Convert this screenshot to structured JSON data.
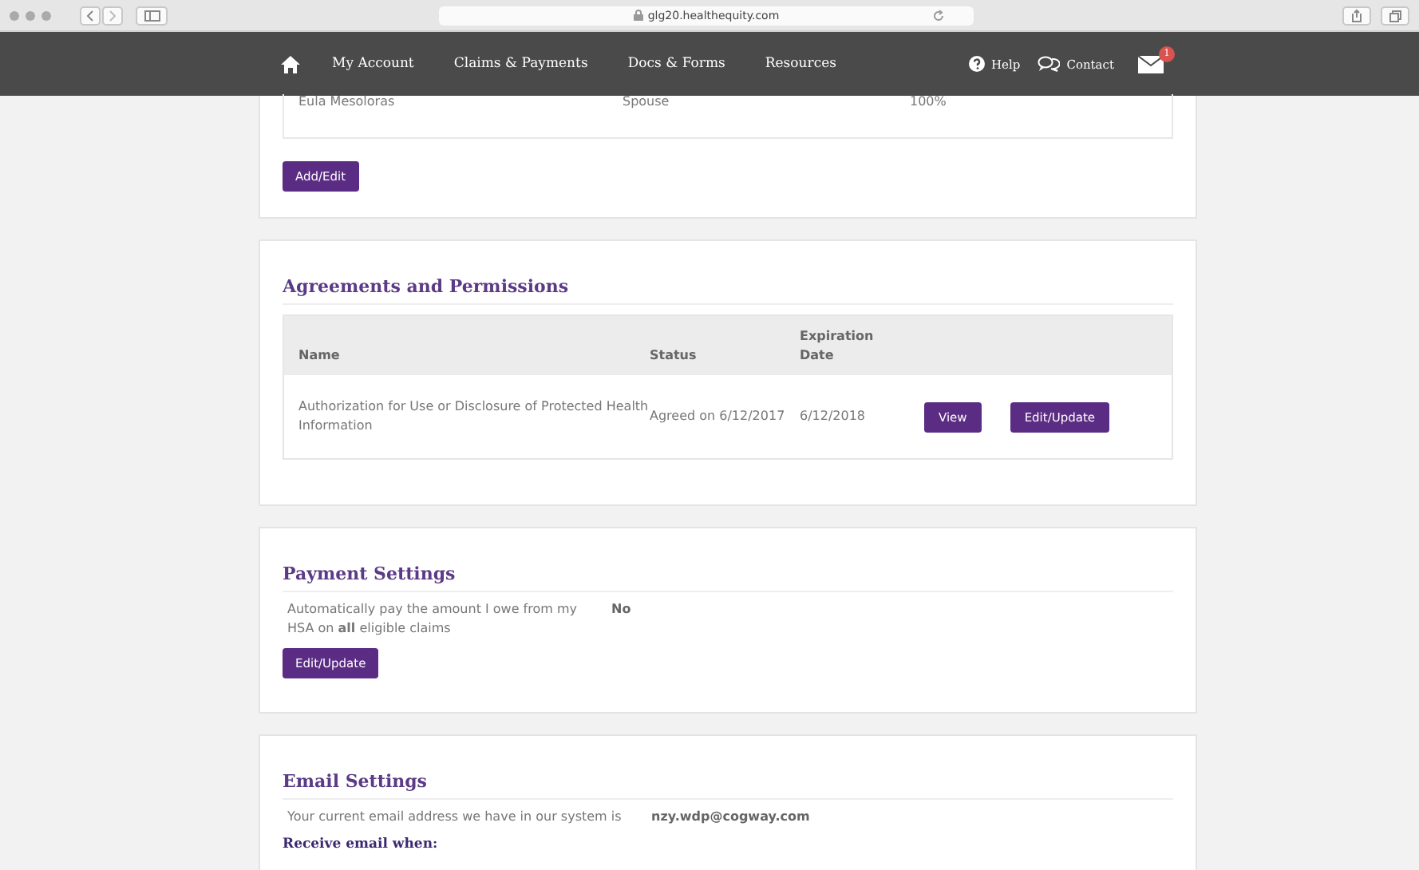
{
  "browser": {
    "url": "glg20.healthequity.com"
  },
  "nav": {
    "items": [
      "My Account",
      "Claims & Payments",
      "Docs & Forms",
      "Resources"
    ],
    "help": "Help",
    "contact": "Contact",
    "mail_badge": "1"
  },
  "beneficiaries": {
    "rows": [
      {
        "name": "Eula Mesoloras",
        "relationship": "Spouse",
        "percent": "100%"
      }
    ],
    "button": "Add/Edit"
  },
  "agreements": {
    "title": "Agreements and Permissions",
    "columns": [
      "Name",
      "Status",
      "Expiration Date"
    ],
    "rows": [
      {
        "name": "Authorization for Use or Disclosure of Protected Health Information",
        "status": "Agreed on 6/12/2017",
        "expiration": "6/12/2018",
        "actions": [
          "View",
          "Edit/Update"
        ]
      }
    ]
  },
  "payment": {
    "title": "Payment Settings",
    "label": "Automatically pay the amount I owe from my HSA on **all** eligible claims",
    "value": "No",
    "button": "Edit/Update"
  },
  "email": {
    "title": "Email Settings",
    "label": "Your current email address we have in our system is",
    "value": "nzy.wdp@cogway.com",
    "subheading": "Receive email when:"
  }
}
